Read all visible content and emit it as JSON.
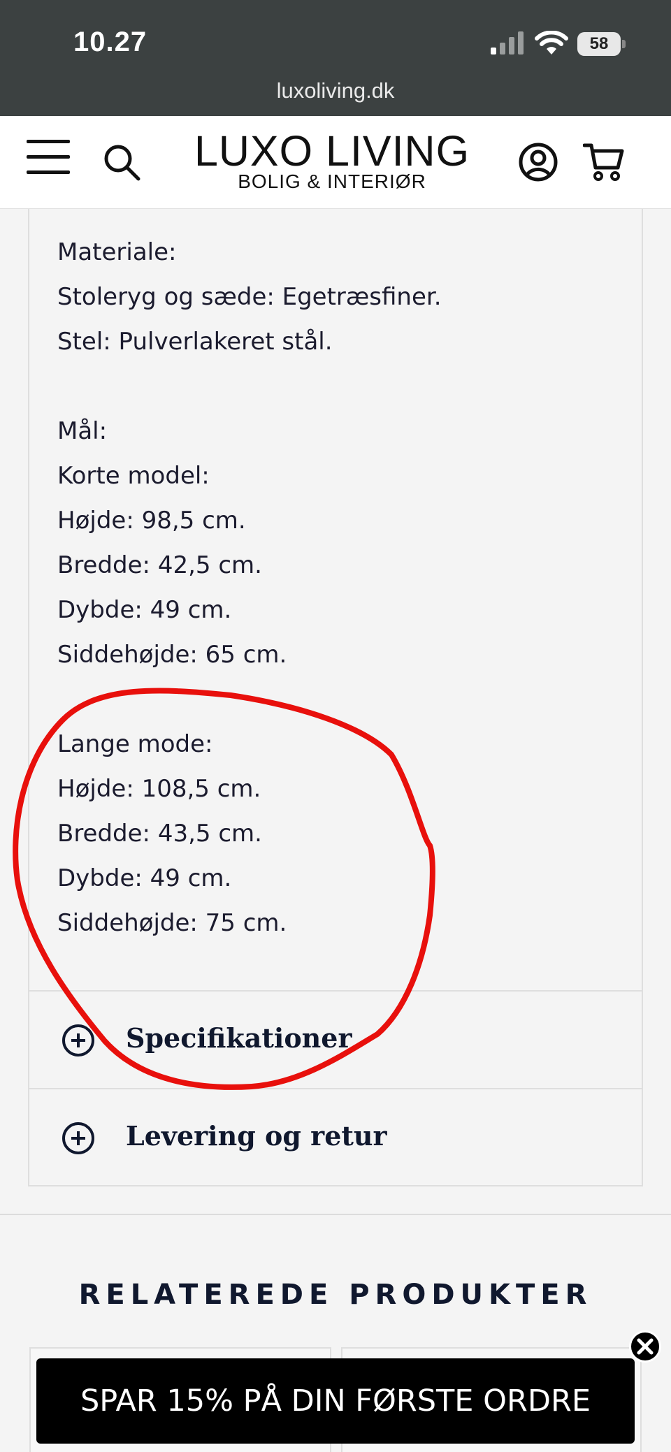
{
  "status_bar": {
    "time": "10.27",
    "battery": "58",
    "url": "luxoliving.dk"
  },
  "header": {
    "logo_title": "LUXO LIVING",
    "logo_subtitle": "BOLIG & INTERIØR",
    "icons": [
      "menu-icon",
      "search-icon",
      "account-icon",
      "cart-icon"
    ]
  },
  "description": {
    "lines": [
      "Materiale:",
      "Stoleryg og sæde: Egetræsfiner.",
      "Stel: Pulverlakeret stål.",
      "",
      "Mål:",
      "Korte model:",
      "Højde: 98,5 cm.",
      "Bredde: 42,5 cm.",
      "Dybde: 49 cm.",
      "Siddehøjde: 65 cm.",
      "",
      "Lange mode:",
      "Højde: 108,5 cm.",
      "Bredde: 43,5 cm.",
      "Dybde: 49 cm.",
      "Siddehøjde: 75 cm."
    ]
  },
  "accordion": [
    {
      "label": "Specifikationer",
      "icon": "plus-circle-icon"
    },
    {
      "label": "Levering og retur",
      "icon": "plus-circle-icon"
    }
  ],
  "related": {
    "title": "RELATEREDE PRODUKTER"
  },
  "promo": {
    "text": "SPAR 15% PÅ DIN FØRSTE ORDRE"
  },
  "colors": {
    "status_bar_bg": "#3c4141",
    "text_dark": "#10182e",
    "annotation_red": "#e8100c",
    "promo_bg": "#000000"
  }
}
